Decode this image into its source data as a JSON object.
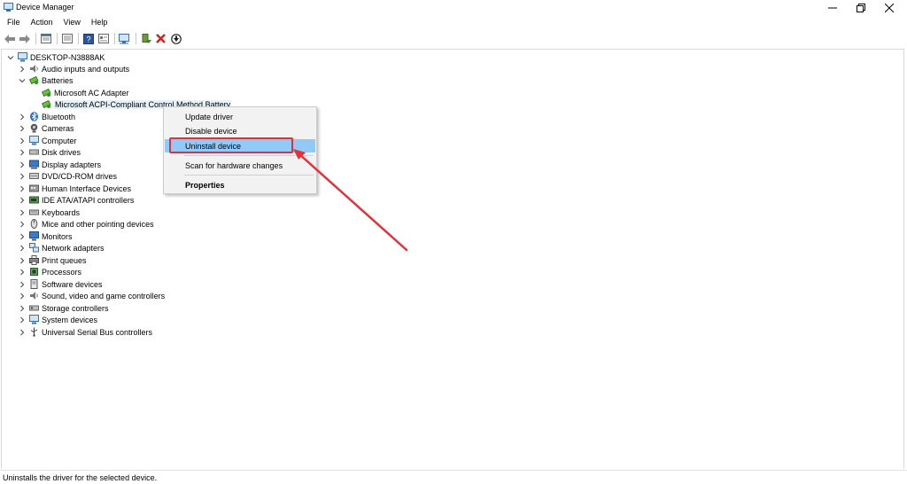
{
  "window": {
    "title": "Device Manager",
    "icon": "device-manager-icon"
  },
  "menu": [
    "File",
    "Action",
    "View",
    "Help"
  ],
  "toolbar": {
    "buttons": [
      "back-arrow-icon",
      "forward-arrow-icon",
      "properties-icon",
      "refresh-icon",
      "help-icon",
      "view-icon",
      "scan-hardware-icon",
      "update-driver-icon",
      "uninstall-icon",
      "disable-icon"
    ]
  },
  "tree": {
    "root": "DESKTOP-N3888AK",
    "items": [
      "Audio inputs and outputs",
      "Batteries",
      "Microsoft AC Adapter",
      "Microsoft ACPI-Compliant Control Method Battery",
      "Bluetooth",
      "Cameras",
      "Computer",
      "Disk drives",
      "Display adapters",
      "DVD/CD-ROM drives",
      "Human Interface Devices",
      "IDE ATA/ATAPI controllers",
      "Keyboards",
      "Mice and other pointing devices",
      "Monitors",
      "Network adapters",
      "Print queues",
      "Processors",
      "Software devices",
      "Sound, video and game controllers",
      "Storage controllers",
      "System devices",
      "Universal Serial Bus controllers"
    ]
  },
  "context_menu": {
    "items": [
      "Update driver",
      "Disable device",
      "Uninstall device",
      "Scan for hardware changes",
      "Properties"
    ],
    "hovered": "Uninstall device"
  },
  "status": {
    "text": "Uninstalls the driver for the selected device."
  },
  "colors": {
    "highlight": "#e0323d",
    "hover": "#91c9f7"
  }
}
